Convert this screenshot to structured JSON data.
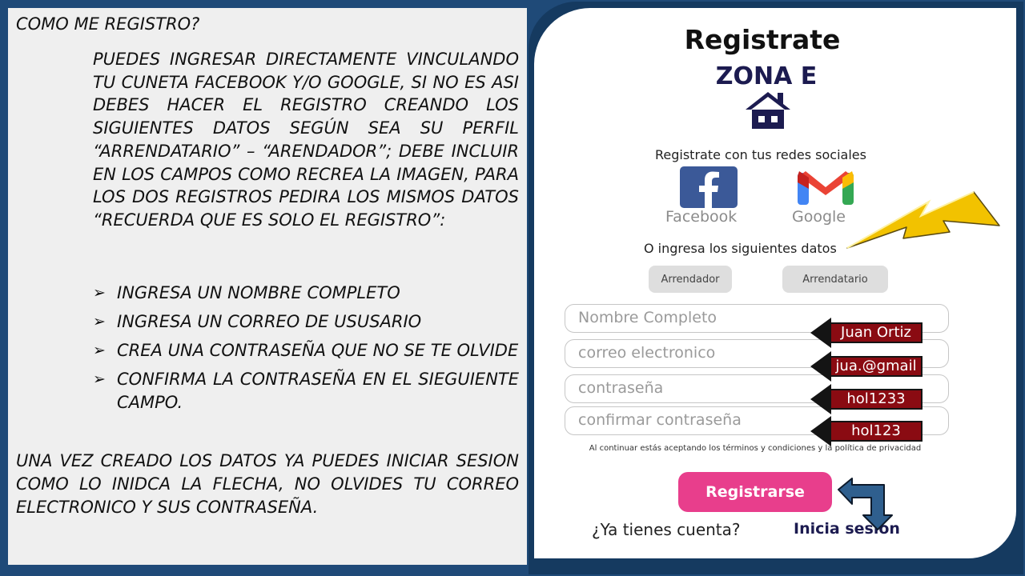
{
  "instructions": {
    "title": "COMO ME REGISTRO?",
    "intro": "PUEDES INGRESAR DIRECTAMENTE VINCULANDO TU CUNETA FACEBOOK Y/O GOOGLE, SI NO ES ASI DEBES HACER EL REGISTRO CREANDO LOS SIGUIENTES DATOS SEGÚN SEA SU PERFIL “ARRENDATARIO” – “ARENDADOR”; DEBE INCLUIR EN LOS CAMPOS COMO RECREA LA IMAGEN, PARA LOS DOS REGISTROS PEDIRA LOS MISMOS DATOS “RECUERDA QUE ES SOLO EL REGISTRO”:",
    "bullet_glyph": "➢",
    "steps": [
      "INGRESA UN NOMBRE COMPLETO",
      "INGRESA UN CORREO DE USUSARIO",
      "CREA UNA CONTRASEÑA QUE NO SE TE OLVIDE",
      "CONFIRMA LA CONTRASEÑA EN EL SIEGUIENTE CAMPO."
    ],
    "outro": "UNA VEZ CREADO LOS DATOS YA PUEDES INICIAR SESION COMO LO INIDCA LA FLECHA, NO OLVIDES TU CORREO ELECTRONICO Y SUS CONTRASEÑA."
  },
  "form": {
    "title": "Registrate",
    "brand": "ZONA E",
    "brand_icon": "house-icon",
    "social_title": "Registrate con tus redes sociales",
    "facebook_label": "Facebook",
    "google_label": "Google",
    "or_text": "O ingresa los siguientes datos",
    "role_options": [
      "Arrendador",
      "Arrendatario"
    ],
    "fields": [
      {
        "placeholder": "Nombre Completo"
      },
      {
        "placeholder": "correo electronico"
      },
      {
        "placeholder": "contraseña"
      },
      {
        "placeholder": "confirmar contraseña"
      }
    ],
    "terms": "Al continuar estás aceptando los términos y condiciones y la política de privacidad",
    "register_label": "Registrarse",
    "have_account": "¿Ya tienes cuenta?",
    "login_link": "Inicia sesion"
  },
  "annotations": {
    "values": [
      "Juan Ortiz",
      "jua.@gmail",
      "hol1233",
      "hol123"
    ]
  },
  "colors": {
    "background": "#1f4a78",
    "brand": "#1c1b50",
    "register_button": "#e83e8c",
    "facebook": "#3b5998",
    "tag_fill": "#8a0b12",
    "lightning": "#f2c200",
    "login_arrow": "#2f5f8e"
  }
}
